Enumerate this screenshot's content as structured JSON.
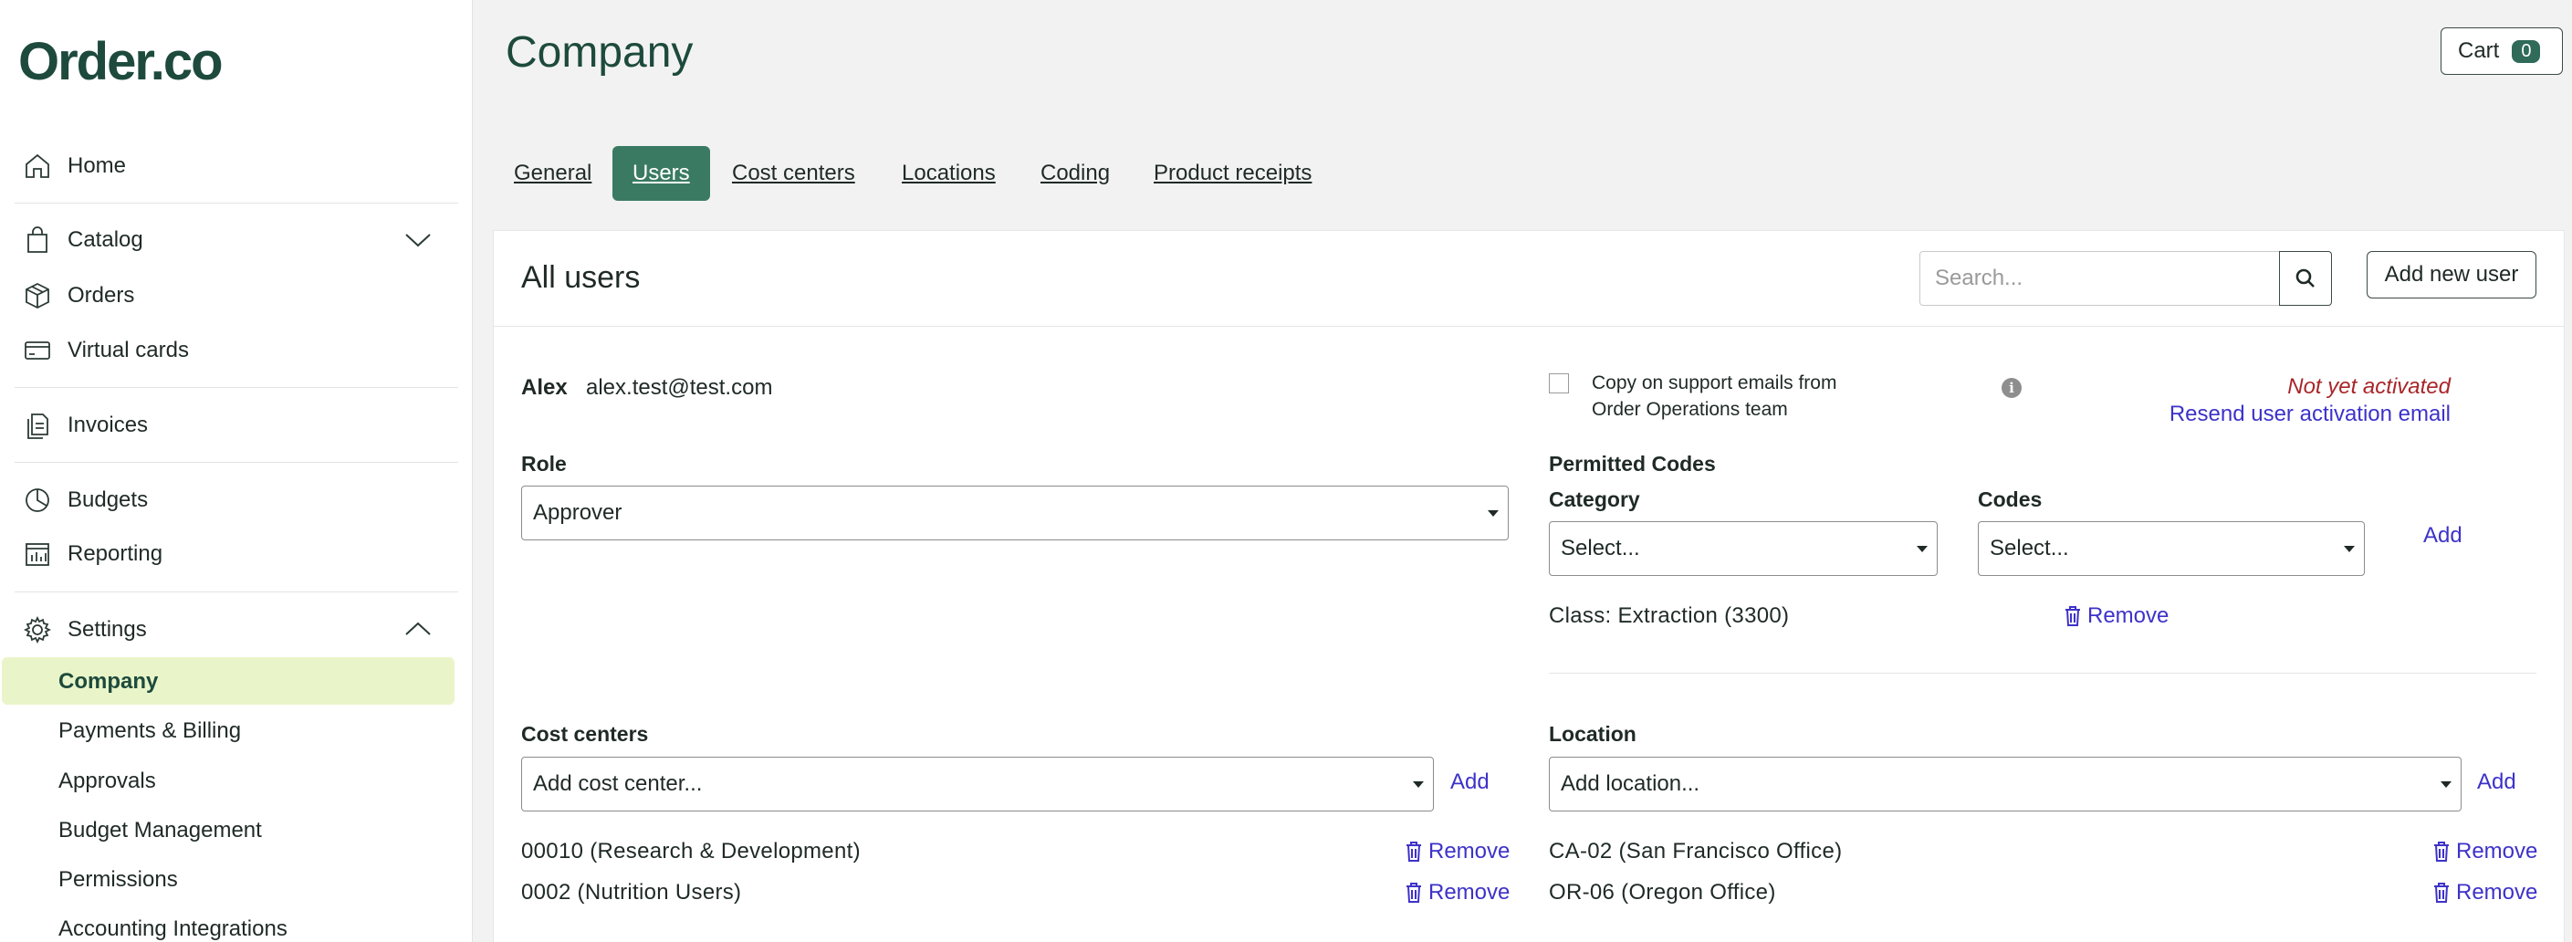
{
  "brand": {
    "logo": "Order.co"
  },
  "sidebar": {
    "items": [
      {
        "label": "Home",
        "icon": "home-icon"
      },
      {
        "label": "Catalog",
        "icon": "shopping-bag-icon"
      },
      {
        "label": "Orders",
        "icon": "box-icon"
      },
      {
        "label": "Virtual cards",
        "icon": "card-icon"
      },
      {
        "label": "Invoices",
        "icon": "documents-icon"
      },
      {
        "label": "Budgets",
        "icon": "pie-chart-icon"
      },
      {
        "label": "Reporting",
        "icon": "bar-chart-icon"
      },
      {
        "label": "Settings",
        "icon": "gear-icon"
      }
    ],
    "settings_sub": [
      "Company",
      "Payments & Billing",
      "Approvals",
      "Budget Management",
      "Permissions",
      "Accounting Integrations"
    ]
  },
  "header": {
    "title": "Company",
    "cart_label": "Cart",
    "cart_count": "0"
  },
  "tabs": [
    "General",
    "Users",
    "Cost centers",
    "Locations",
    "Coding",
    "Product receipts"
  ],
  "panel": {
    "title": "All users",
    "search_placeholder": "Search...",
    "add_user_label": "Add new user"
  },
  "user": {
    "name": "Alex",
    "email": "alex.test@test.com",
    "copy_support_label": "Copy on support emails from Order Operations team",
    "status": "Not yet activated",
    "resend_label": "Resend user activation email",
    "role_label": "Role",
    "role_value": "Approver",
    "permitted_codes_label": "Permitted Codes",
    "category_label": "Category",
    "category_placeholder": "Select...",
    "codes_label": "Codes",
    "codes_placeholder": "Select...",
    "add_label": "Add",
    "remove_label": "Remove",
    "permitted_code_item": "Class: Extraction (3300)",
    "cost_centers_label": "Cost centers",
    "cost_center_placeholder": "Add cost center...",
    "cost_centers": [
      "00010 (Research & Development)",
      "0002 (Nutrition Users)"
    ],
    "location_label": "Location",
    "location_placeholder": "Add location...",
    "locations": [
      "CA-02 (San Francisco Office)",
      "OR-06 (Oregon Office)"
    ]
  },
  "colors": {
    "brand_green": "#1d4a3c",
    "tab_active": "#3a7a63",
    "link": "#3d32c9",
    "status_red": "#a8262a",
    "active_highlight": "#e9f5c9"
  }
}
